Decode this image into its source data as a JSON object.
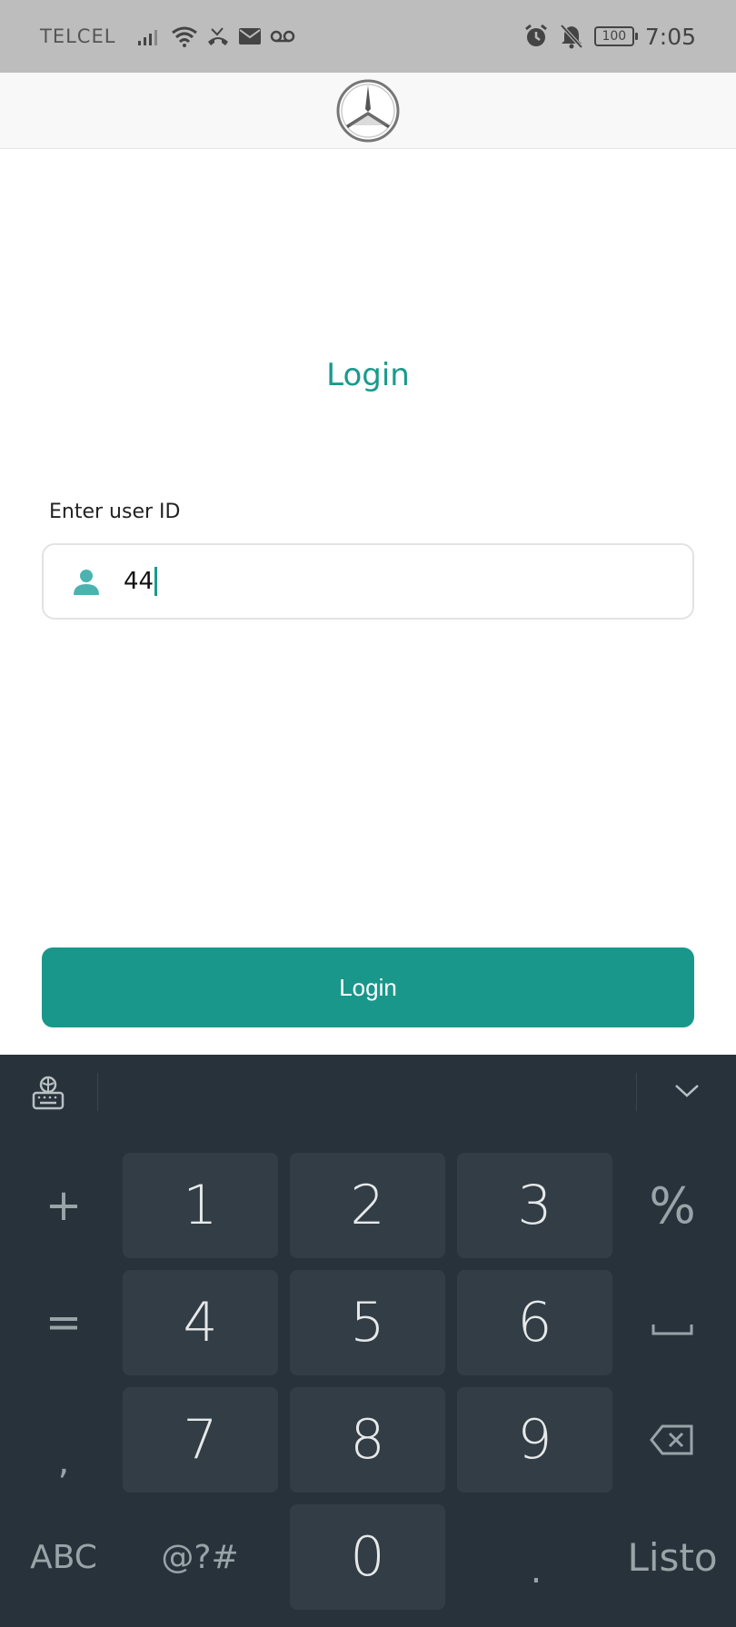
{
  "status_bar": {
    "carrier": "TELCEL",
    "battery": "100",
    "time": "7:05",
    "icons": [
      "signal-icon",
      "wifi-icon",
      "missed-call-icon",
      "mail-icon",
      "voicemail-icon",
      "alarm-icon",
      "mute-icon",
      "battery-icon"
    ]
  },
  "header": {
    "logo": "mercedes-star-logo"
  },
  "login": {
    "title": "Login",
    "user_id_label": "Enter user ID",
    "user_id_value": "44",
    "button_label": "Login"
  },
  "keyboard": {
    "digits": [
      "1",
      "2",
      "3",
      "4",
      "5",
      "6",
      "7",
      "8",
      "9",
      "0"
    ],
    "left_keys": [
      "+",
      "=",
      ","
    ],
    "right_keys": [
      "%"
    ],
    "abc_label": "ABC",
    "symbols_label": "@?#",
    "dot_label": ".",
    "done_label": "Listo"
  },
  "colors": {
    "accent": "#1a978b",
    "keyboard_bg": "#28323a",
    "key_bg": "#323d45"
  }
}
